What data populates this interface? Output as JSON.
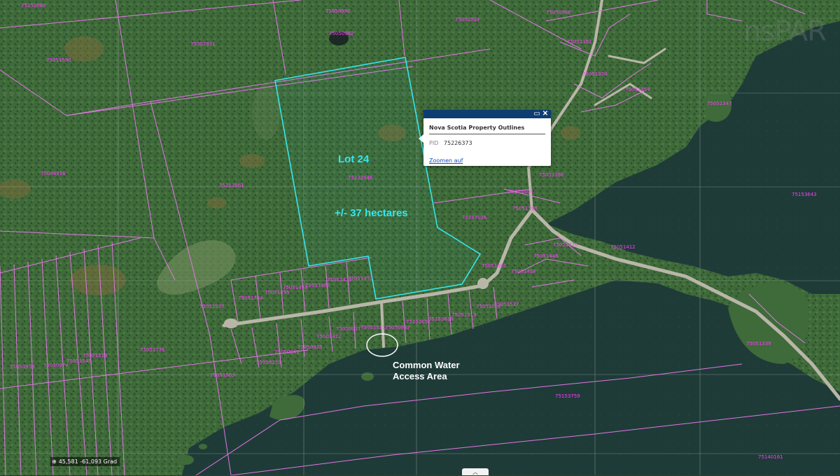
{
  "popup": {
    "title": "Nova Scotia Property Outlines",
    "pid_key": "PID",
    "pid_value": "75226373",
    "zoom_link": "Zoomen auf",
    "maximize_icon": "maximize-icon",
    "close_icon": "close-icon"
  },
  "lot": {
    "name": "Lot 24",
    "area": "+/- 37 hectares",
    "outline_color": "#35e6ef"
  },
  "annotation": {
    "line1": "Common Water",
    "line2": "Access Area"
  },
  "status": {
    "coordinates": "45,581 -61,093 Grad",
    "crosshair_icon": "crosshair-icon"
  },
  "bottom_tab_icon": "chevron-up-icon",
  "watermark": "nsPAR",
  "parcel_line_color": "#e277e6",
  "pid_label_color": "#ff3cff",
  "parcel_pids": [
    "75226373",
    "75153643",
    "75153759",
    "75140161",
    "75152660",
    "75050990",
    "75050982",
    "75002931",
    "75051590",
    "75002924",
    "75050966",
    "75044926",
    "75213561",
    "75132946",
    "75157026",
    "75051537",
    "75051776",
    "75050958",
    "75050974",
    "75051545",
    "75051528",
    "75051503",
    "75056213",
    "75050941",
    "75050925",
    "75002912",
    "75050917",
    "75051511",
    "75050933",
    "75152652",
    "75153610",
    "75051519",
    "75051024",
    "75051527",
    "75051784",
    "75051495",
    "75051479",
    "75051487",
    "75051471",
    "75051453",
    "75051461",
    "75051438",
    "75051446",
    "75051420",
    "75051412",
    "75051404",
    "75051396",
    "75051388",
    "75051370",
    "75051362",
    "75051354",
    "75051347",
    "75051339"
  ]
}
